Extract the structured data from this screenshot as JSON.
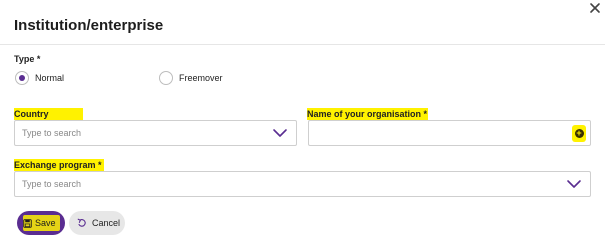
{
  "dialog": {
    "title": "Institution/enterprise",
    "close_icon": "close-icon"
  },
  "type": {
    "label": "Type *",
    "options": [
      {
        "label": "Normal",
        "selected": true
      },
      {
        "label": "Freemover",
        "selected": false
      }
    ]
  },
  "country": {
    "label": "Country",
    "placeholder": "Type to search",
    "icon": "chevron-down-icon"
  },
  "organisation": {
    "label": "Name of your organisation *",
    "icon": "add-circle-icon"
  },
  "exchange_program": {
    "label": "Exchange program *",
    "placeholder": "Type to search",
    "icon": "chevron-down-icon"
  },
  "actions": {
    "save_label": "Save",
    "cancel_label": "Cancel"
  },
  "colors": {
    "accent": "#5a2d91",
    "highlight": "#fff200",
    "border": "#cfcfcf",
    "cancel_bg": "#e7e7e7"
  }
}
